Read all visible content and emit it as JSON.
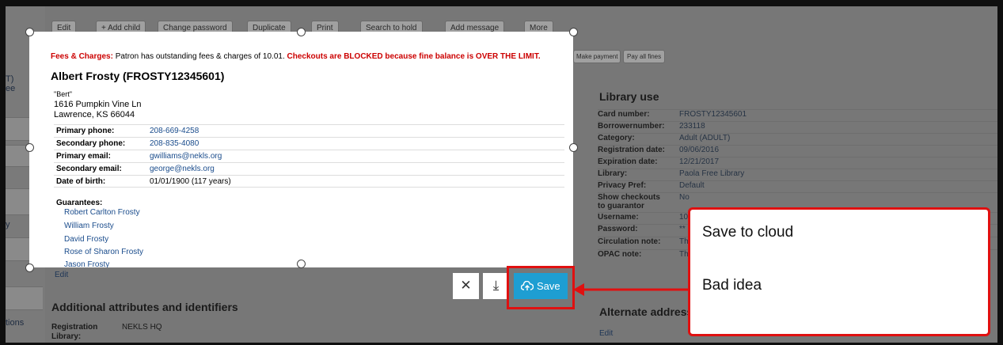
{
  "left_fragments": [
    "T)",
    "ee",
    "y",
    "tions"
  ],
  "toolbar": {
    "buttons": [
      "Edit",
      "+ Add child",
      "Change password",
      "Duplicate",
      "Print",
      "Search to hold",
      "Add message",
      "More"
    ]
  },
  "fees": {
    "label": "Fees & Charges:",
    "text": " Patron has outstanding fees & charges of 10.01. ",
    "blocked": "Checkouts are BLOCKED because fine balance is OVER THE LIMIT.",
    "make_payment": "Make payment",
    "pay_all": "Pay all fines"
  },
  "patron": {
    "name": "Albert Frosty (FROSTY12345601)",
    "nickname": "\"Bert\"",
    "address1": "1616 Pumpkin Vine Ln",
    "address2": "Lawrence, KS 66044"
  },
  "contact": [
    {
      "label": "Primary phone:",
      "value": "208-669-4258"
    },
    {
      "label": "Secondary phone:",
      "value": "208-835-4080"
    },
    {
      "label": "Primary email:",
      "value": "gwilliams@nekls.org"
    },
    {
      "label": "Secondary email:",
      "value": "george@nekls.org"
    },
    {
      "label": "Date of birth:",
      "value": "01/01/1900 (117 years)"
    }
  ],
  "guarantees": {
    "label": "Guarantees:",
    "names": [
      "Robert Carlton Frosty",
      "William Frosty",
      "David Frosty",
      "Rose of Sharon Frosty",
      "Jason Frosty"
    ]
  },
  "edit_link": "Edit",
  "library_use": {
    "heading": "Library use",
    "rows": [
      {
        "label": "Card number:",
        "value": "FROSTY12345601"
      },
      {
        "label": "Borrowernumber:",
        "value": "233118"
      },
      {
        "label": "Category:",
        "value": "Adult (ADULT)"
      },
      {
        "label": "Registration date:",
        "value": "09/06/2016"
      },
      {
        "label": "Expiration date:",
        "value": "12/21/2017"
      },
      {
        "label": "Library:",
        "value": "Paola Free Library"
      },
      {
        "label": "Privacy Pref:",
        "value": "Default"
      },
      {
        "label": "Show checkouts",
        "value": "No"
      },
      {
        "label": "to guarantor",
        "value": ""
      },
      {
        "label": "Username:",
        "value": "10"
      },
      {
        "label": "Password:",
        "value": "**"
      },
      {
        "label": "Circulation note:",
        "value": "Th"
      },
      {
        "label": "OPAC note:",
        "value": "Th"
      }
    ]
  },
  "additional": {
    "heading": "Additional attributes and identifiers",
    "reg_label": "Registration",
    "reg_label2": "Library:",
    "reg_value": "NEKLS HQ"
  },
  "alternate": {
    "heading": "Alternate address",
    "edit": "Edit"
  },
  "crop_toolbar": {
    "close_glyph": "✕",
    "download_glyph": "⤓",
    "save_label": "Save"
  },
  "callout": {
    "line1": "Save to cloud",
    "line2": "Bad idea"
  },
  "colors": {
    "save_button": "#1e9ed2",
    "highlight_red": "#e01010",
    "link_blue": "#1a4c8c",
    "alert_red": "#cc0000"
  }
}
